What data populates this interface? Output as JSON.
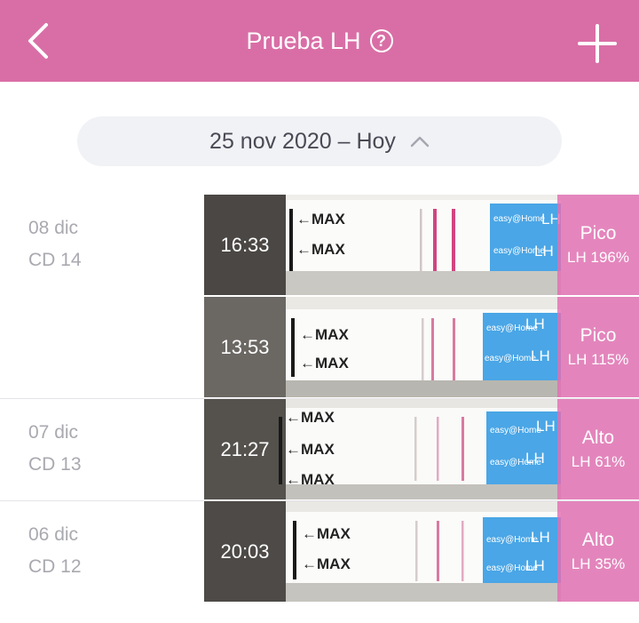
{
  "header": {
    "title": "Prueba LH",
    "background": "#d96ea6",
    "back_icon": "chevron-left-icon",
    "help_icon": "question-circle-icon",
    "help_symbol": "?",
    "add_icon": "plus-icon"
  },
  "range": {
    "label": "25 nov 2020 – Hoy",
    "icon": "chevron-up-icon"
  },
  "days": [
    {
      "date": "08 dic",
      "cycle_day": "CD 14"
    },
    {
      "date": "07 dic",
      "cycle_day": "CD 13"
    },
    {
      "date": "06 dic",
      "cycle_day": "CD 12"
    }
  ],
  "entries": [
    {
      "time": "16:33",
      "level": "Pico",
      "lh": "LH 196%",
      "strip_text": "←MAX",
      "brand": "easy@Home",
      "test_text": "LH"
    },
    {
      "time": "13:53",
      "level": "Pico",
      "lh": "LH 115%",
      "strip_text": "←MAX",
      "brand": "easy@Home",
      "test_text": "LH"
    },
    {
      "time": "21:27",
      "level": "Alto",
      "lh": "LH 61%",
      "strip_text": "←MAX",
      "brand": "easy@Home",
      "test_text": "LH"
    },
    {
      "time": "20:03",
      "level": "Alto",
      "lh": "LH 35%",
      "strip_text": "←MAX",
      "brand": "easy@Home",
      "test_text": "LH"
    }
  ],
  "colors": {
    "accent": "#d96ea6",
    "result_overlay": "#e26fb3",
    "test_line": "#d0457f",
    "strip_blue": "#4aa6e6"
  }
}
